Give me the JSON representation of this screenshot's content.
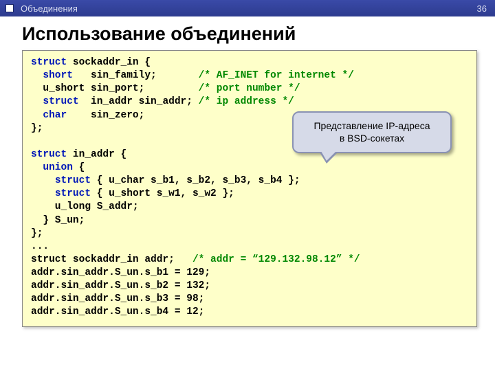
{
  "header": {
    "section": "Объединения",
    "page": "36"
  },
  "title": "Использование объединений",
  "callout": {
    "line1": "Представление IP-адреса",
    "line2": "в BSD-сокетах"
  },
  "code": {
    "l1_kw": "struct",
    "l1_rest": " sockaddr_in {",
    "l2_kw": "short",
    "l2_mid": "   sin_family;       ",
    "l2_cm": "/* AF_INET for internet */",
    "l3_pre": "  u_short sin_port;         ",
    "l3_cm": "/* port number */",
    "l4_kw": "struct",
    "l4_mid": "  in_addr sin_addr; ",
    "l4_cm": "/* ip address */",
    "l5_kw": "char",
    "l5_rest": "    sin_zero;",
    "l6": "};",
    "l7": "",
    "l8_kw": "struct",
    "l8_rest": " in_addr {",
    "l9_kw": "union",
    "l9_rest": " {",
    "l10_kw": "struct",
    "l10_rest": " { u_char s_b1, s_b2, s_b3, s_b4 };",
    "l11_kw": "struct",
    "l11_rest": " { u_short s_w1, s_w2 };",
    "l12": "    u_long S_addr;",
    "l13": "  } S_un;",
    "l14": "};",
    "l15": "...",
    "l16_pre": "struct sockaddr_in addr;   ",
    "l16_cm": "/* addr = “129.132.98.12” */",
    "l17": "addr.sin_addr.S_un.s_b1 = 129;",
    "l18": "addr.sin_addr.S_un.s_b2 = 132;",
    "l19": "addr.sin_addr.S_un.s_b3 = 98;",
    "l20": "addr.sin_addr.S_un.s_b4 = 12;"
  }
}
